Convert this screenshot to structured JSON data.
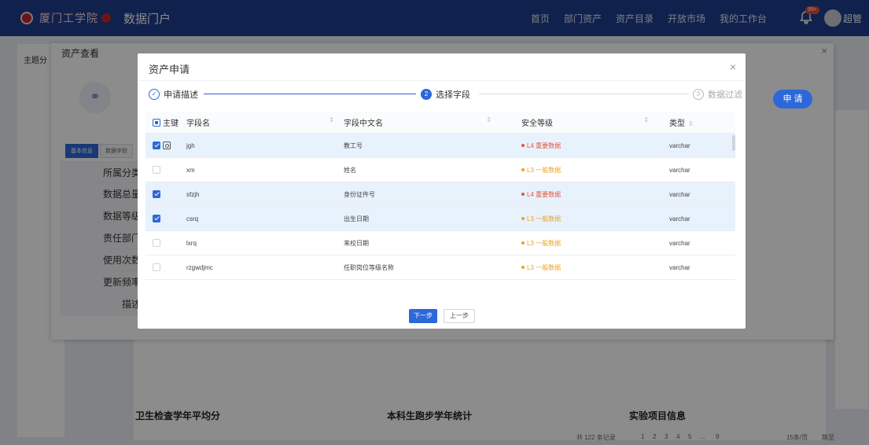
{
  "header": {
    "logo_text": "厦门工学院",
    "portal_title": "数据门户",
    "nav": [
      "首页",
      "部门资产",
      "资产目录",
      "开放市场",
      "我的工作台"
    ],
    "badge": "99+",
    "user": "超管"
  },
  "background": {
    "sidebar_title": "主题分",
    "card_titles": [
      "卫生检查学年平均分",
      "本科生跑步学年统计",
      "实验项目信息"
    ],
    "pager_total": "共 122 条记录",
    "pager_pages": [
      "1",
      "2",
      "3",
      "4",
      "5",
      "...",
      "9"
    ],
    "pager_size": "15条/页",
    "pager_goto": "跳至"
  },
  "panel": {
    "title": "资产查看",
    "tabs": [
      "基本信息",
      "数据字段"
    ],
    "attributes": [
      "所属分类",
      "数据总量",
      "数据等级",
      "责任部门",
      "使用次数",
      "更新频率",
      "描述"
    ]
  },
  "dialog": {
    "title": "资产申请",
    "steps": [
      {
        "num": "✓",
        "label": "申请描述",
        "state": "done"
      },
      {
        "num": "2",
        "label": "选择字段",
        "state": "current"
      },
      {
        "num": "3",
        "label": "数据过滤",
        "state": "wait"
      }
    ],
    "apply_label": "申 请",
    "columns": {
      "key": "主键",
      "name": "字段名",
      "cn_name": "字段中文名",
      "security": "安全等级",
      "type": "类型"
    },
    "rows": [
      {
        "selected": true,
        "key": true,
        "name": "jgh",
        "cn_name": "教工号",
        "security": "L4 重要数据",
        "level_color": "#e8553e",
        "type": "varchar"
      },
      {
        "selected": false,
        "key": false,
        "name": "xm",
        "cn_name": "姓名",
        "security": "L3 一般数据",
        "level_color": "#f0a020",
        "type": "varchar"
      },
      {
        "selected": true,
        "key": false,
        "name": "sfzjh",
        "cn_name": "身份证件号",
        "security": "L4 重要数据",
        "level_color": "#e8553e",
        "type": "varchar"
      },
      {
        "selected": true,
        "key": false,
        "name": "csrq",
        "cn_name": "出生日期",
        "security": "L3 一般数据",
        "level_color": "#f0a020",
        "type": "varchar"
      },
      {
        "selected": false,
        "key": false,
        "name": "lxrq",
        "cn_name": "来校日期",
        "security": "L3 一般数据",
        "level_color": "#f0a020",
        "type": "varchar"
      },
      {
        "selected": false,
        "key": false,
        "name": "rzgwdjmc",
        "cn_name": "任职岗位等级名称",
        "security": "L3 一般数据",
        "level_color": "#f0a020",
        "type": "varchar"
      }
    ],
    "next_label": "下一步",
    "prev_label": "上一步"
  }
}
